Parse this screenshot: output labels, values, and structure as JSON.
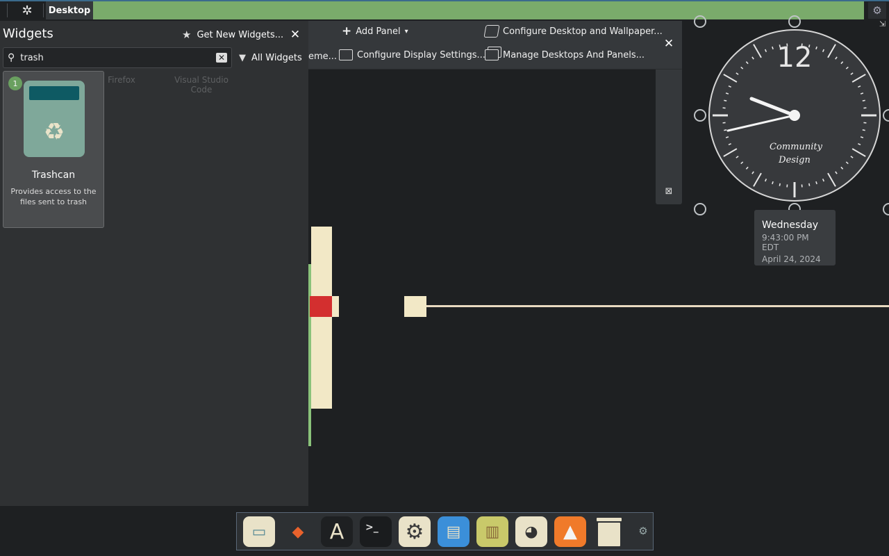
{
  "top_panel": {
    "desktop_tab": "Desktop",
    "logo": "kde-icon",
    "settings_icon": "gear-icon"
  },
  "widgets": {
    "title": "Widgets",
    "get_new": "Get New Widgets...",
    "search_value": "trash",
    "filter": "All Widgets",
    "card": {
      "count": "1",
      "name": "Trashcan",
      "description": "Provides access to the files sent to trash"
    },
    "ghost_labels": [
      "Firefox",
      "Visual Studio\nCode"
    ]
  },
  "toolbar": {
    "add_panel": "Add Panel",
    "theme_fragment": "eme...",
    "configure_display": "Configure Display Settings...",
    "configure_desktop": "Configure Desktop and Wallpaper...",
    "manage_desktops": "Manage Desktops And Panels..."
  },
  "clock": {
    "twelve": "12",
    "brand_line1": "Community",
    "brand_line2": "Design"
  },
  "tooltip": {
    "day": "Wednesday",
    "time": "9:43:00 PM EDT",
    "date": "April 24, 2024"
  },
  "dock": {
    "items": [
      "files",
      "gitlab",
      "fonts",
      "terminal",
      "settings",
      "screenshot",
      "image-viewer",
      "gimp",
      "vlc",
      "trash"
    ]
  },
  "colors": {
    "panel_green": "#7aab6b",
    "accent_blue": "#3b6a8c",
    "cream": "#f2e8c6",
    "red": "#d32f2f"
  }
}
